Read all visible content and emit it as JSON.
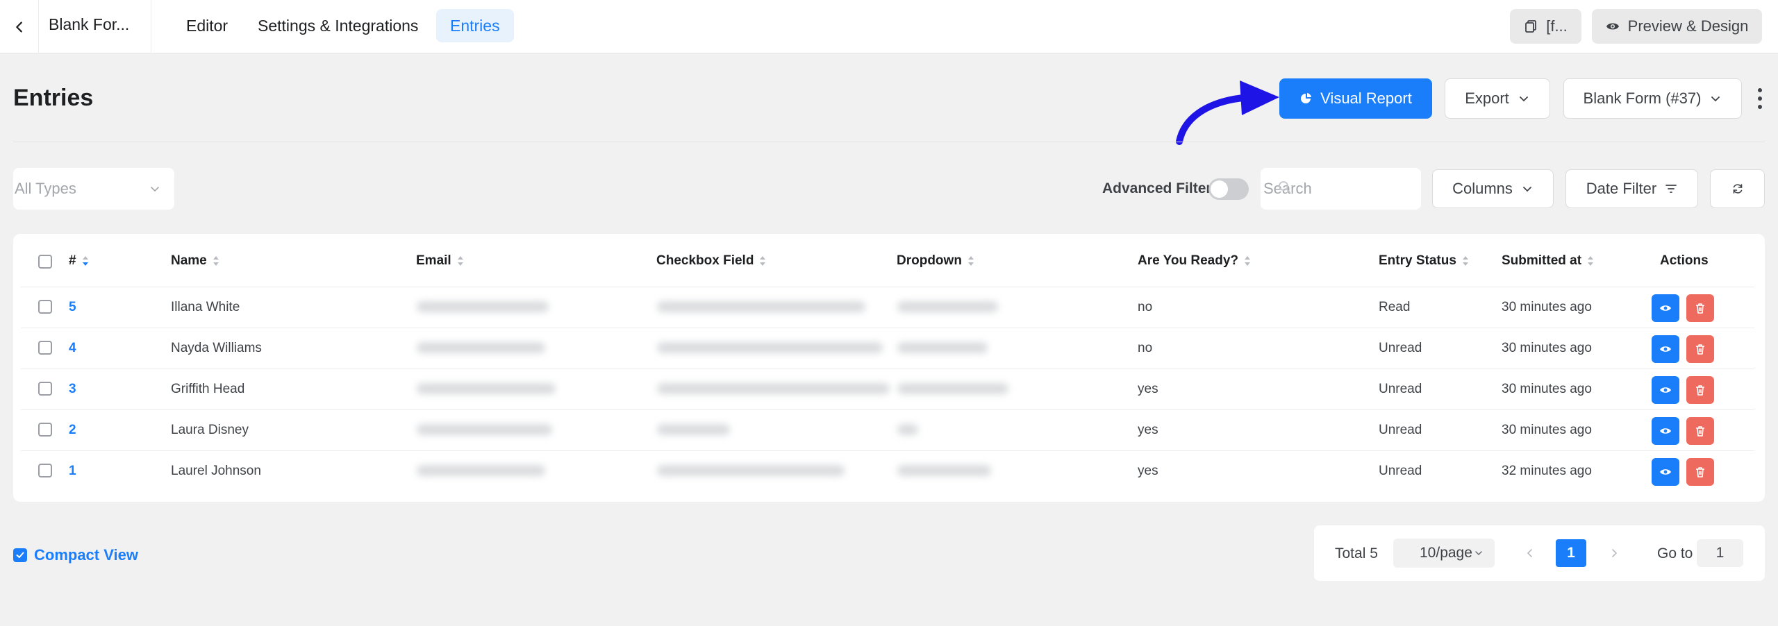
{
  "colors": {
    "accent": "#1a7efb",
    "danger": "#ef6a5e",
    "annotation_arrow": "#1f14e6"
  },
  "topbar": {
    "form_name": "Blank For...",
    "tabs": [
      {
        "label": "Editor",
        "active": false
      },
      {
        "label": "Settings & Integrations",
        "active": false
      },
      {
        "label": "Entries",
        "active": true
      }
    ],
    "shortcode_label": "[f...",
    "preview_label": "Preview & Design"
  },
  "header": {
    "title": "Entries",
    "visual_report_label": "Visual Report",
    "export_label": "Export",
    "form_select_label": "Blank Form (#37)"
  },
  "filters": {
    "types_placeholder": "All Types",
    "advanced_filter_label": "Advanced Filter",
    "advanced_filter_on": false,
    "search_placeholder": "Search",
    "columns_label": "Columns",
    "date_filter_label": "Date Filter"
  },
  "table": {
    "columns": [
      "#",
      "Name",
      "Email",
      "Checkbox Field",
      "Dropdown",
      "Are You Ready?",
      "Entry Status",
      "Submitted at",
      "Actions"
    ],
    "rows": [
      {
        "id": "5",
        "name": "Illana White",
        "ready": "no",
        "status": "Read",
        "submitted": "30 minutes ago"
      },
      {
        "id": "4",
        "name": "Nayda Williams",
        "ready": "no",
        "status": "Unread",
        "submitted": "30 minutes ago"
      },
      {
        "id": "3",
        "name": "Griffith Head",
        "ready": "yes",
        "status": "Unread",
        "submitted": "30 minutes ago"
      },
      {
        "id": "2",
        "name": "Laura Disney",
        "ready": "yes",
        "status": "Unread",
        "submitted": "30 minutes ago"
      },
      {
        "id": "1",
        "name": "Laurel Johnson",
        "ready": "yes",
        "status": "Unread",
        "submitted": "32 minutes ago"
      }
    ]
  },
  "footer": {
    "compact_view_label": "Compact View",
    "compact_view_checked": true,
    "total_label": "Total 5",
    "per_page_label": "10/page",
    "current_page": "1",
    "goto_label": "Go to",
    "goto_value": "1"
  }
}
